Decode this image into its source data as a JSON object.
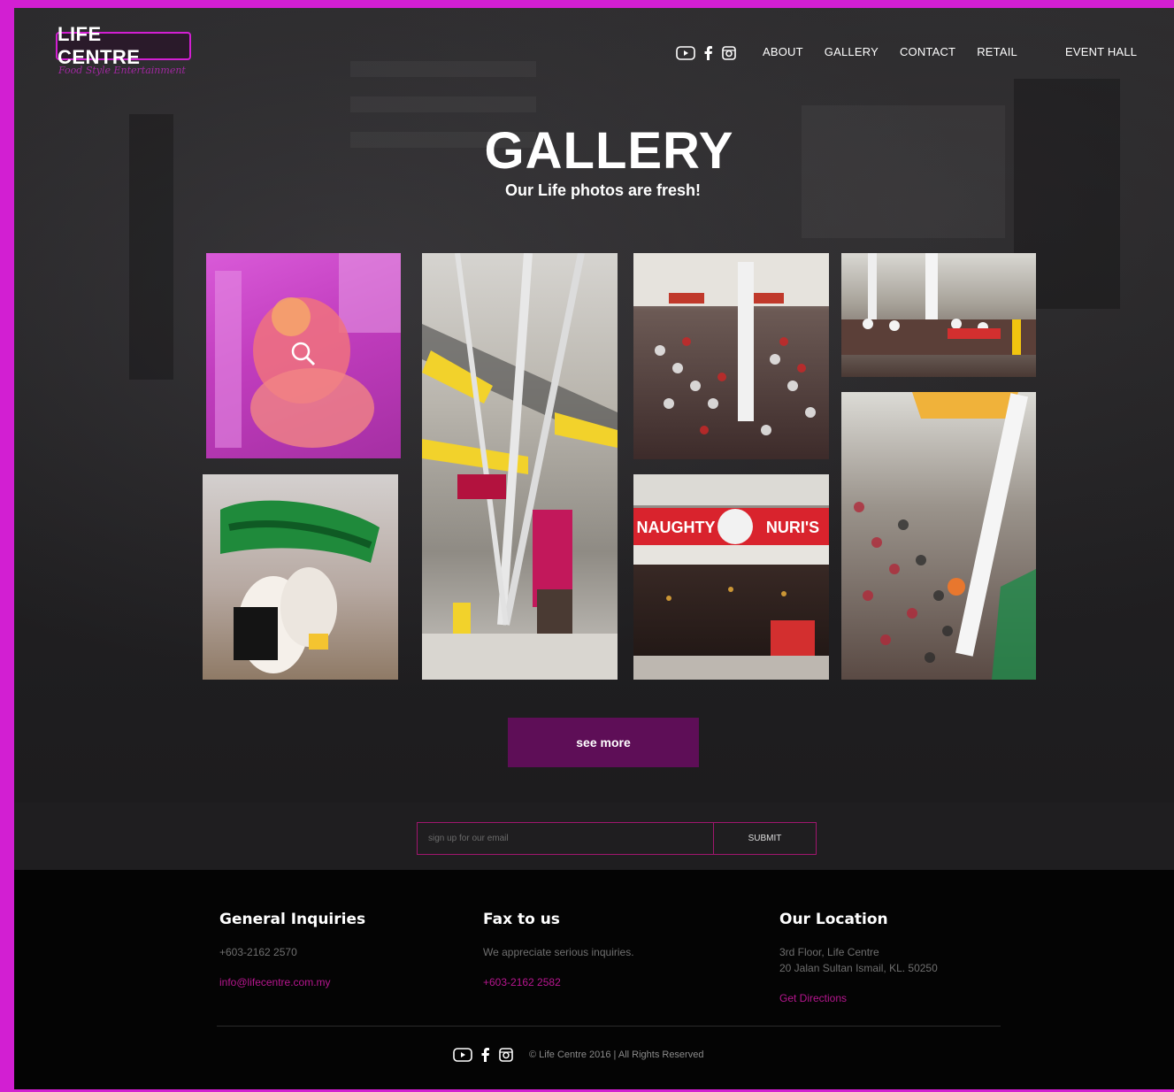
{
  "brand": {
    "name": "LIFE CENTRE",
    "tagline": "Food Style Entertainment"
  },
  "header": {
    "social_icons": [
      "youtube-icon",
      "facebook-icon",
      "instagram-icon"
    ],
    "nav": [
      "ABOUT",
      "GALLERY",
      "CONTACT",
      "RETAIL",
      "EVENT HALL"
    ]
  },
  "hero": {
    "title": "GALLERY",
    "subtitle": "Our Life photos are fresh!"
  },
  "gallery": {
    "photos": [
      {
        "subject": "lion dance",
        "highlighted": true
      },
      {
        "subject": "atrium tree decorations"
      },
      {
        "subject": "banquet crowd overhead"
      },
      {
        "subject": "dining hall"
      },
      {
        "subject": "lion dance performers"
      },
      {
        "subject": "NAUGHTY NURI'S storefront",
        "sign": "NAUGHTY NURI'S"
      },
      {
        "subject": "atrium event crowd"
      }
    ],
    "see_more_label": "see more"
  },
  "signup": {
    "placeholder": "sign up for our email",
    "submit_label": "SUBMIT"
  },
  "footer": {
    "inquiries": {
      "title": "General Inquiries",
      "phone": "+603-2162 2570",
      "email": "info@lifecentre.com.my"
    },
    "fax": {
      "title": "Fax to us",
      "text": "We appreciate serious inquiries.",
      "number": "+603-2162 2582"
    },
    "location": {
      "title": "Our Location",
      "line1": "3rd Floor, Life Centre",
      "line2": "20 Jalan Sultan Ismail, KL. 50250",
      "directions": "Get Directions"
    },
    "copyright": "© Life Centre 2016 | All Rights Reserved",
    "social_icons": [
      "youtube-icon",
      "facebook-icon",
      "instagram-icon"
    ]
  },
  "colors": {
    "accent": "#d21fd2",
    "button": "#5e0e57",
    "link": "#b7168f"
  }
}
